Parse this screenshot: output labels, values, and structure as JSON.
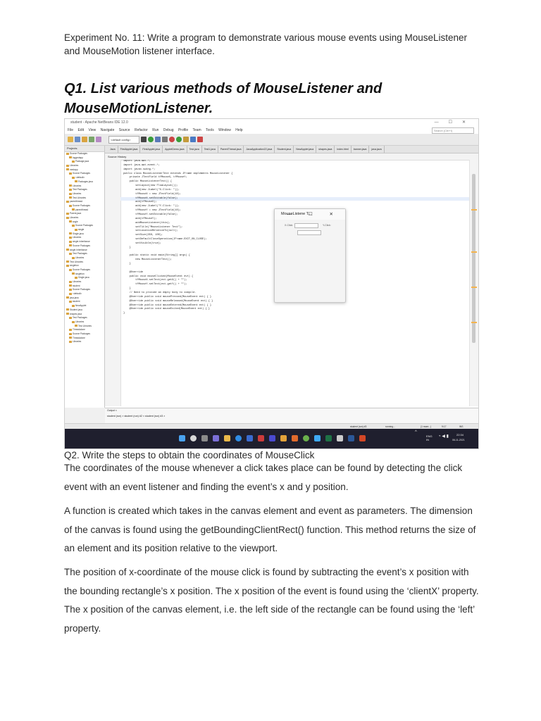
{
  "experiment": "Experiment No. 11: Write a program to demonstrate various mouse events using MouseListener and MouseMotion listener interface.",
  "q1": "Q1. List various methods of MouseListener and MouseMotionListener.",
  "screenshot": {
    "ide_title": "student - Apache NetBeans IDE 12.0",
    "menu": [
      "File",
      "Edit",
      "View",
      "Navigate",
      "Source",
      "Refactor",
      "Run",
      "Debug",
      "Profile",
      "Team",
      "Tools",
      "Window",
      "Help"
    ],
    "search_placeholder": "Search (Ctrl+I)",
    "config_combo": "<default config>",
    "projects_header": "Projects",
    "tree": [
      "Source Packages",
      "loggedapp",
      "Package.java",
      "Libraries",
      "medapp",
      "Source Packages",
      "<default>",
      "Packages.java",
      "Libraries",
      "Test Packages",
      "Libraries",
      "Test Libraries",
      "parentthread",
      "Source Packages",
      "parentthread",
      "Parent.java",
      "Libraries",
      "sngle",
      "Source Packages",
      "single",
      "Single.java",
      "Libraries",
      "single.inheritance",
      "Source Packages",
      "single.inheritance",
      "Test Packages",
      "Libraries",
      "Test Libraries",
      "singleton",
      "Source Packages",
      "singleton",
      "Single.java",
      "Libraries",
      "student",
      "Source Packages",
      "<default>",
      "java.java",
      "student",
      "NewApplet",
      "Student.java",
      "shapes.java",
      "Test Packages",
      "Libraries",
      "Test Libraries",
      "Threadalone",
      "Source Packages",
      "Threadalone",
      "Libraries"
    ],
    "tabs": [
      "Java",
      "FirstApplet.java",
      "FirstApplet.java",
      "AppletDemo.java",
      "Test.java",
      "Test1.java",
      "ParentThread.java",
      "JavaApplication22.java",
      "Student.java",
      "NewApplet.java",
      "shapes.java",
      "index.html",
      "banner.java",
      "java.java"
    ],
    "editor_toolbar": "Source   History",
    "code_lines": [
      "import java.awt.*;",
      "import java.awt.event.*;",
      "import javax.swing.*;",
      "public class MouseListenerTest extends JFrame implements MouseListener {",
      "    private JTextField tfMouseX, tfMouseY;",
      "    public MouseListenerTest() {",
      "        setLayout(new FlowLayout());",
      "        add(new JLabel(\"X-Click: \"));",
      "        tfMouseX = new JTextField(10);",
      "        tfMouseX.setEditable(false);",
      "        add(tfMouseX);",
      "        add(new JLabel(\"Y-Click: \"));",
      "        tfMouseY = new JTextField(10);",
      "        tfMouseY.setEditable(false);",
      "        add(tfMouseY);",
      "        addMouseListener(this);",
      "        setTitle(\"MouseListener Test\");",
      "        setLocationRelativeTo(null);",
      "        setSize(350, 100);",
      "        setDefaultCloseOperation(JFrame.EXIT_ON_CLOSE);",
      "        setVisible(true);",
      "    }",
      "",
      "    public static void main(String[] args) {",
      "        new MouseListenerTest();",
      "    }",
      "",
      "    @Override",
      "    public void mouseClicked(MouseEvent evt) {",
      "        tfMouseX.setText(evt.getX() + \"\");",
      "        tfMouseY.setText(evt.getY() + \"\");",
      "    }",
      "    // Need to provide an empty body to compile.",
      "    @Override public void mousePressed(MouseEvent evt) { }",
      "    @Override public void mouseReleased(MouseEvent evt) { }",
      "    @Override public void mouseEntered(MouseEvent evt) { }",
      "    @Override public void mouseExited(MouseEvent evt) { }",
      "}"
    ],
    "frame_title": "MouseListene T...",
    "frame_controls": "— ☐ ✕",
    "frame_x_label": "X-Click:",
    "frame_y_label": "Y-Click:",
    "output_tab": "Output ×",
    "output_subtabs": "student (run) ×    student (run) #2 ×    student (run) #3 ×",
    "status_left": "student (run) #3",
    "status_running": "running...",
    "status_mode": "INS",
    "status_pos": "9:17",
    "status_zoom": "(1 more...)",
    "taskbar_lang": "ENG IN",
    "taskbar_time": "22:34",
    "taskbar_date": "06-11-2021",
    "colors": {
      "taskbar": "#1f1f2e",
      "editor_bg": "#ffffff",
      "keyword": "#0000e6"
    }
  },
  "q2": "Q2. Write the steps to obtain the coordinates of MouseClick",
  "p1": "The coordinates of the mouse whenever a click takes place can be found by detecting the click event with an event listener and finding the event’s x and y position.",
  "p2": "A function is created which takes in the canvas element and event as parameters. The dimension of the canvas is found using the getBoundingClientRect() function. This method returns the size of an element and its position relative to the viewport.",
  "p3": "The position of x-coordinate of the mouse click is found by subtracting the event’s x position with the bounding rectangle’s x position. The x position of the event is found using the ‘clientX’ property. The x position of the canvas element, i.e. the left side of the rectangle can be found using the ‘left’ property."
}
